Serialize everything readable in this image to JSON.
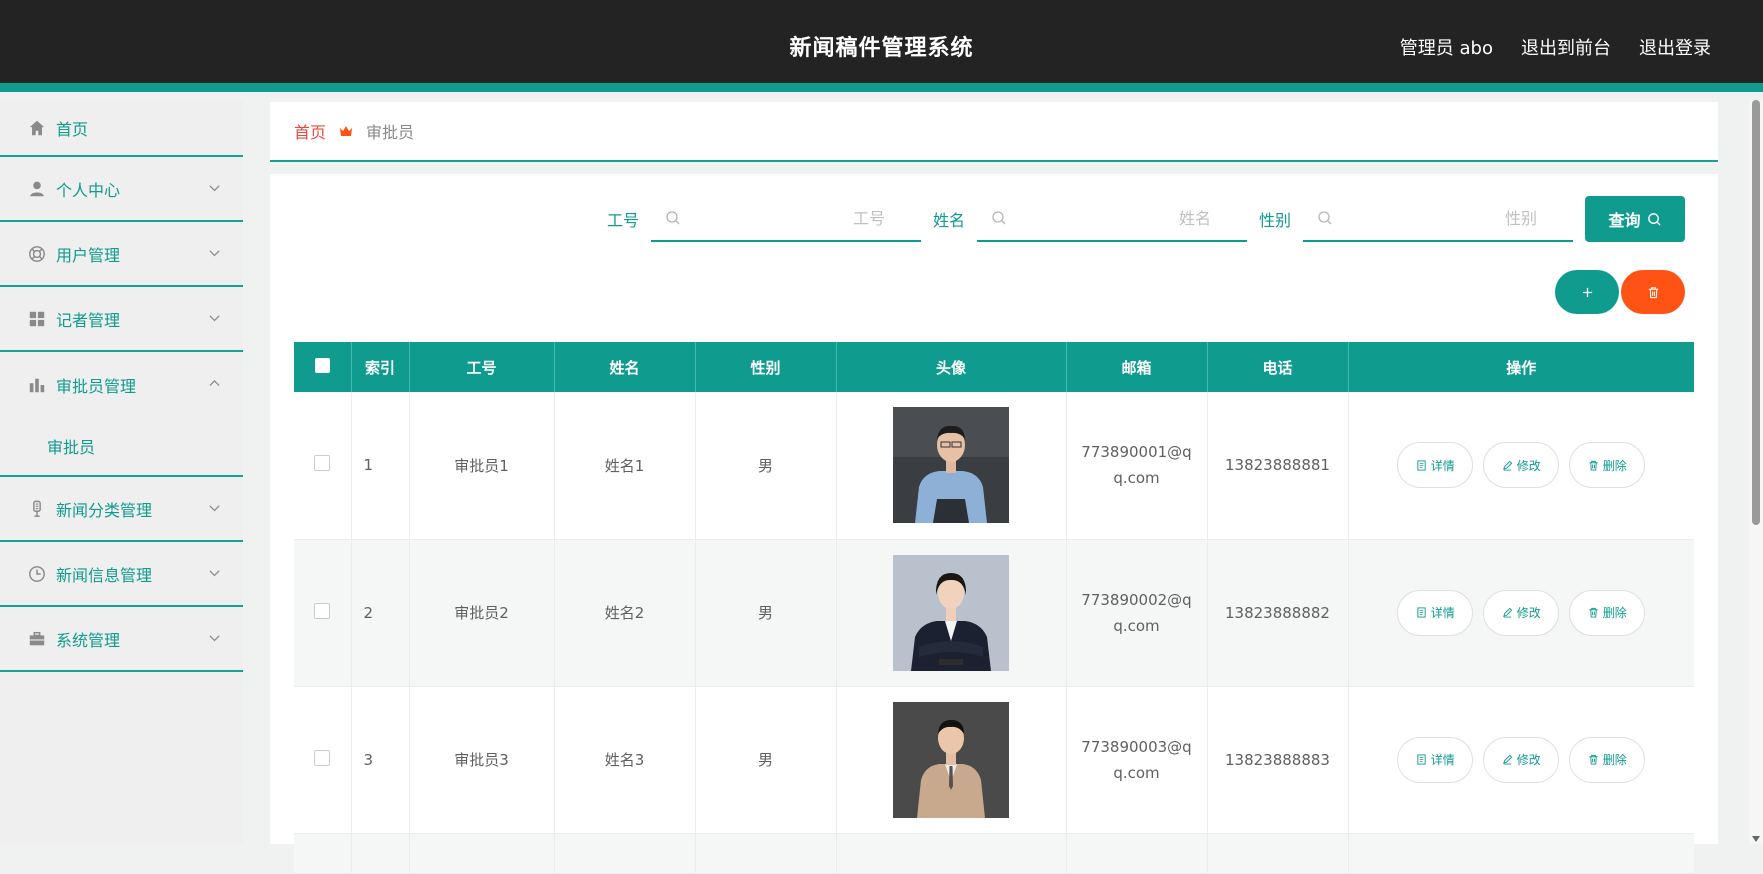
{
  "header": {
    "title": "新闻稿件管理系统",
    "admin_label": "管理员 abo",
    "front_link": "退出到前台",
    "logout_link": "退出登录"
  },
  "sidebar": {
    "items": [
      {
        "label": "首页",
        "icon": "home-icon"
      },
      {
        "label": "个人中心",
        "icon": "user-icon"
      },
      {
        "label": "用户管理",
        "icon": "lifebuoy-icon"
      },
      {
        "label": "记者管理",
        "icon": "grid-icon"
      },
      {
        "label": "审批员管理",
        "icon": "bar-chart-icon"
      },
      {
        "label": "新闻分类管理",
        "icon": "microphone-icon"
      },
      {
        "label": "新闻信息管理",
        "icon": "clock-icon"
      },
      {
        "label": "系统管理",
        "icon": "briefcase-icon"
      }
    ],
    "sub_item": "审批员"
  },
  "breadcrumb": {
    "home": "首页",
    "current": "审批员"
  },
  "search": {
    "field1_label": "工号",
    "field1_placeholder": "工号",
    "field2_label": "姓名",
    "field2_placeholder": "姓名",
    "field3_label": "性别",
    "field3_placeholder": "性别",
    "query_button": "查询"
  },
  "table": {
    "headers": {
      "index": "索引",
      "job_no": "工号",
      "name": "姓名",
      "gender": "性别",
      "avatar": "头像",
      "email": "邮箱",
      "phone": "电话",
      "actions": "操作"
    },
    "rows": [
      {
        "index": "1",
        "job_no": "审批员1",
        "name": "姓名1",
        "gender": "男",
        "email_1": "773890001@q",
        "email_2": "q.com",
        "phone": "13823888881"
      },
      {
        "index": "2",
        "job_no": "审批员2",
        "name": "姓名2",
        "gender": "男",
        "email_1": "773890002@q",
        "email_2": "q.com",
        "phone": "13823888882"
      },
      {
        "index": "3",
        "job_no": "审批员3",
        "name": "姓名3",
        "gender": "男",
        "email_1": "773890003@q",
        "email_2": "q.com",
        "phone": "13823888883"
      }
    ],
    "btn_detail": "详情",
    "btn_edit": "修改",
    "btn_delete": "删除"
  },
  "colors": {
    "primary": "#0f9b8e",
    "danger": "#ff5316",
    "header_bg": "#232323",
    "breadcrumb_home": "#e94b3c"
  }
}
